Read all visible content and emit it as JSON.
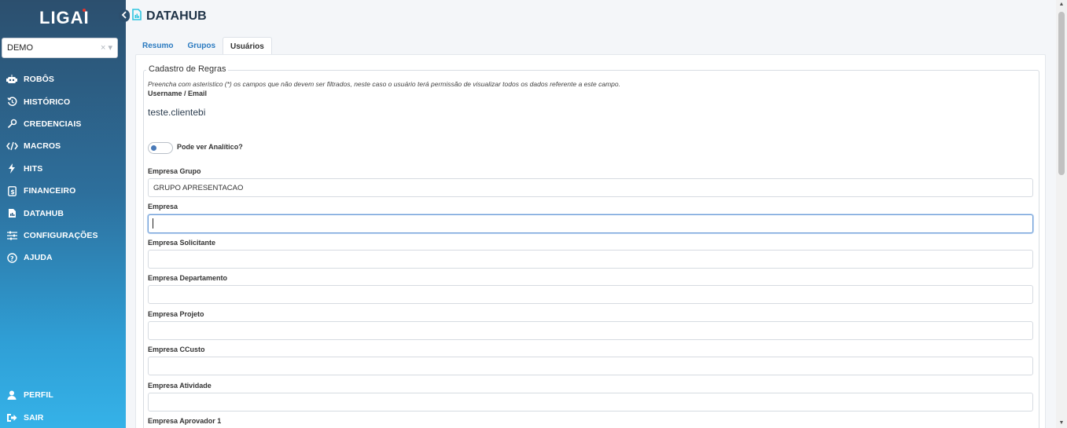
{
  "brand": {
    "logo_text": "LIGAI"
  },
  "org_select": {
    "value": "DEMO",
    "clear": "×",
    "arrow": "▾"
  },
  "nav": {
    "items": [
      {
        "label": "ROBÔS",
        "icon": "robot-icon"
      },
      {
        "label": "HISTÓRICO",
        "icon": "history-icon"
      },
      {
        "label": "CREDENCIAIS",
        "icon": "key-icon"
      },
      {
        "label": "MACROS",
        "icon": "code-icon"
      },
      {
        "label": "HITS",
        "icon": "bolt-icon"
      },
      {
        "label": "FINANCEIRO",
        "icon": "money-icon"
      },
      {
        "label": "DATAHUB",
        "icon": "datahub-icon"
      },
      {
        "label": "CONFIGURAÇÕES",
        "icon": "sliders-icon"
      },
      {
        "label": "AJUDA",
        "icon": "help-icon"
      }
    ],
    "bottom": [
      {
        "label": "PERFIL",
        "icon": "user-icon"
      },
      {
        "label": "SAIR",
        "icon": "logout-icon"
      }
    ]
  },
  "header": {
    "title": "DATAHUB"
  },
  "tabs": [
    {
      "label": "Resumo",
      "active": false
    },
    {
      "label": "Grupos",
      "active": false
    },
    {
      "label": "Usuários",
      "active": true
    }
  ],
  "form": {
    "legend": "Cadastro de Regras",
    "note": "Preencha com asteristico (*) os campos que não devem ser filtrados, neste caso o usuário terá permissão de visualizar todos os dados referente a este campo.",
    "username_label": "Username / Email",
    "username_value": "teste.clientebi",
    "toggle_label": "Pode ver Analítico?",
    "fields": [
      {
        "label": "Empresa Grupo",
        "value": "GRUPO APRESENTACAO"
      },
      {
        "label": "Empresa",
        "value": ""
      },
      {
        "label": "Empresa Solicitante",
        "value": ""
      },
      {
        "label": "Empresa Departamento",
        "value": ""
      },
      {
        "label": "Empresa Projeto",
        "value": ""
      },
      {
        "label": "Empresa CCusto",
        "value": ""
      },
      {
        "label": "Empresa Atividade",
        "value": ""
      },
      {
        "label": "Empresa Aprovador 1",
        "value": ""
      }
    ]
  },
  "colors": {
    "accent": "#2a7ac0",
    "sidebar_top": "#2c4f6e",
    "sidebar_bottom": "#35b2e8",
    "icon_teal": "#2ec5e0"
  }
}
